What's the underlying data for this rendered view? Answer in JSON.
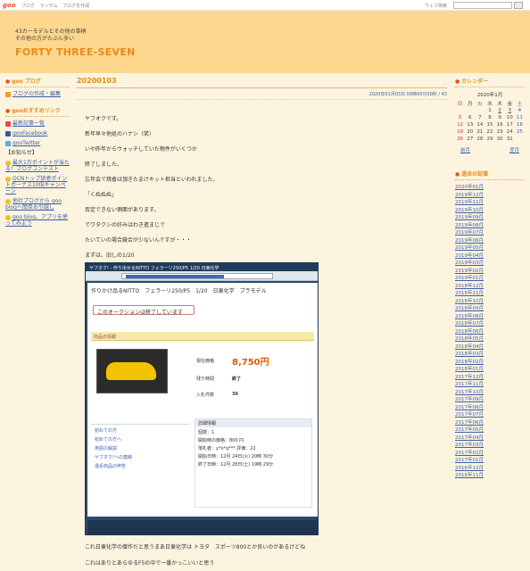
{
  "topbar": {
    "logo": "goo",
    "nav": [
      "ブログ",
      "ランダム",
      "ブログを作成"
    ],
    "search_label": "ウェブ検索"
  },
  "header": {
    "desc1": "43カーモデルとその他の事柄",
    "desc2": "その他の方がたぶん多い",
    "title": "FORTY THREE-SEVEN"
  },
  "left": {
    "blog_title": "goo ブログ",
    "blog_link": "ブログの作成・編集",
    "recommend_title": "gooおすすめリンク",
    "popular": "最新記事一覧",
    "facebook": "gooFacebook",
    "twitter": "gooTwitter",
    "notice": "【お知らせ】",
    "items": [
      "最大1万ポイントが当たる！ブログコンテスト",
      "OCNトップ読者ポイントボーナス10倍キャンペーン",
      "他社ブログから goo blogへ簡単お引越し",
      "goo blog、アプリを使ってみよう"
    ]
  },
  "post": {
    "title": "20200103",
    "date": "2020年01月03日 06時00分00秒 / 43",
    "lines": [
      "ヤフオクです。",
      "新年早々他処のハナシ（笑）",
      "いや昨年からウォッチしていた物件がいくつか",
      "終了しました。",
      "忘年会で焼香は頂きたまけキット担当といわれました。",
      "「くぬぬぬ」",
      "否定できない側面があります。",
      "でワタクシの好みはわき進まじで",
      "たいていの場合競合が少ないんですが・・・",
      "まずは、旧しの1/20"
    ],
    "after": [
      "これ日東化学の傑作だと思うまあ日東化学は トヨタ　スポーツ800とか良いのがあるけどね",
      "これはありとあらゆるF5の中で一番かっこいいと思う"
    ]
  },
  "screenshot": {
    "tab_title": "ヤフオク! - 作り出せるNITTO フェラーリ250/P5 1/20 日東化学",
    "item_title": "作りかけ品るNITTO　フェラーリ250/P5　1/20　日東化学　プラモデル",
    "ended": "このオークションは終了しています",
    "info": "商品の情報",
    "price_label": "現在価格",
    "price": "8,750円",
    "remain_label": "残り時間",
    "remain": "終了",
    "bids_label": "入札件数",
    "bids": "36",
    "side": [
      "初めての方",
      "初めての方へ",
      "用語の解説",
      "ヤフオク!への連絡",
      "違反商品の申告"
    ],
    "detail_head": "詳細情報",
    "detail": [
      "個数：1",
      "開始時の価格：800 円",
      "落札者：y*o*q*** 評価：22",
      "開始日時：12月 24日(火) 20時 30分",
      "終了日時：12月 28日(土) 19時 29分"
    ]
  },
  "calendar": {
    "title": "カレンダー",
    "month": "2020年1月",
    "days": [
      "日",
      "月",
      "火",
      "水",
      "木",
      "金",
      "土"
    ],
    "weeks": [
      [
        "",
        "",
        "",
        "1",
        "2",
        "3",
        "4"
      ],
      [
        "5",
        "6",
        "7",
        "8",
        "9",
        "10",
        "11"
      ],
      [
        "12",
        "13",
        "14",
        "15",
        "16",
        "17",
        "18"
      ],
      [
        "19",
        "20",
        "21",
        "22",
        "23",
        "24",
        "25"
      ],
      [
        "26",
        "27",
        "28",
        "29",
        "30",
        "31",
        ""
      ]
    ],
    "prev": "前月",
    "next": "翌月"
  },
  "archive": {
    "title": "過去の記事",
    "months": [
      "2020年01月",
      "2019年12月",
      "2019年11月",
      "2019年10月",
      "2019年09月",
      "2019年08月",
      "2019年07月",
      "2019年06月",
      "2019年05月",
      "2019年04月",
      "2019年03月",
      "2019年02月",
      "2019年01月",
      "2018年12月",
      "2018年11月",
      "2018年10月",
      "2018年09月",
      "2018年08月",
      "2018年07月",
      "2018年06月",
      "2018年05月",
      "2018年04月",
      "2018年03月",
      "2018年02月",
      "2018年01月",
      "2017年12月",
      "2017年11月",
      "2017年10月",
      "2017年09月",
      "2017年08月",
      "2017年07月",
      "2017年06月",
      "2017年05月",
      "2017年04月",
      "2017年03月",
      "2017年02月",
      "2017年01月",
      "2016年12月",
      "2016年11月"
    ]
  }
}
